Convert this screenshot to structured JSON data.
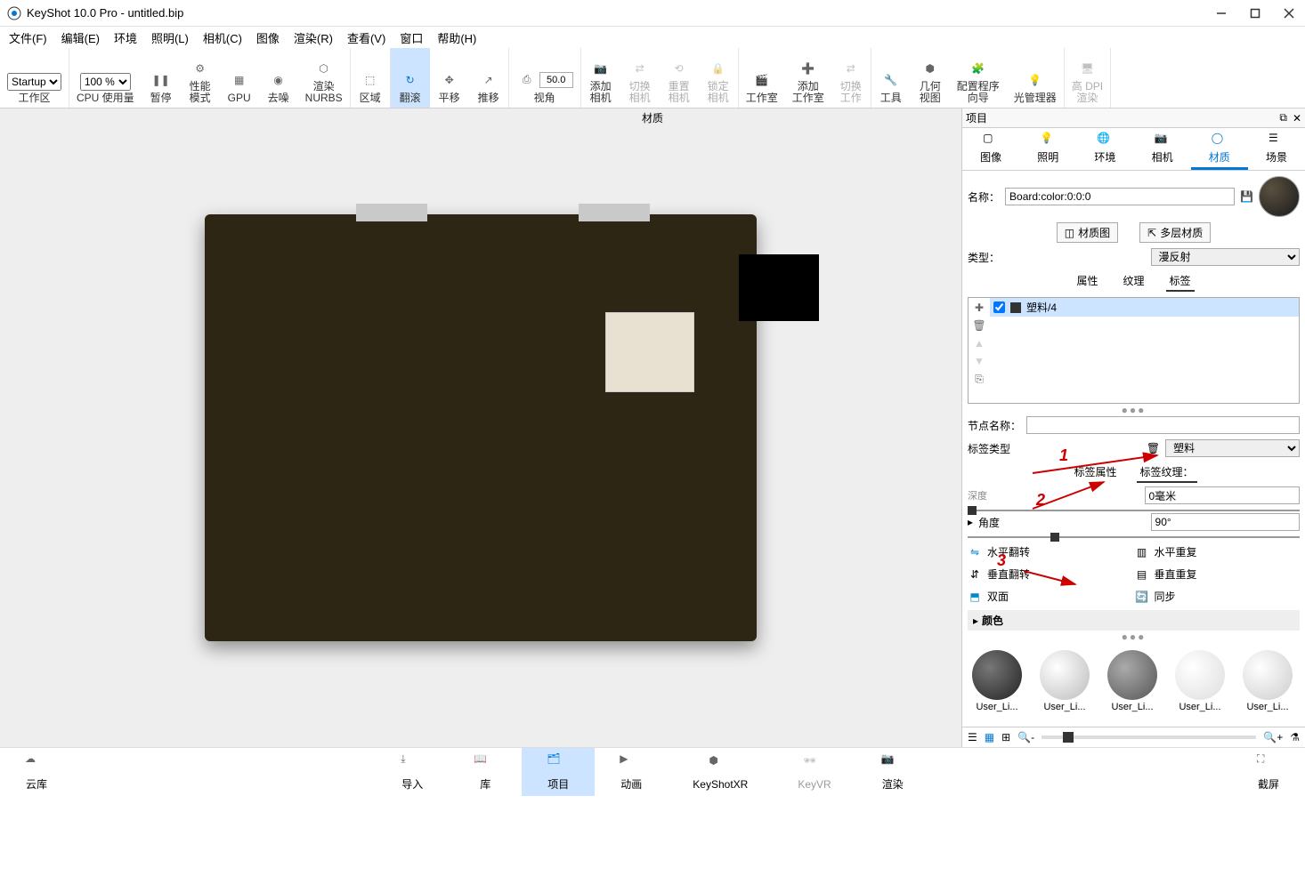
{
  "title": "KeyShot 10.0 Pro  - untitled.bip",
  "menus": [
    "文件(F)",
    "编辑(E)",
    "环境",
    "照明(L)",
    "相机(C)",
    "图像",
    "渲染(R)",
    "查看(V)",
    "窗口",
    "帮助(H)"
  ],
  "toolbar": {
    "startup": "Startup",
    "zoom": "100 %",
    "workspace": "工作区",
    "cpu": "CPU 使用量",
    "pause": "暂停",
    "perf": "性能\n模式",
    "gpu": "GPU",
    "denoise": "去噪",
    "nurbs": "渲染\nNURBS",
    "region": "区域",
    "tumble": "翻滚",
    "pan": "平移",
    "dolly": "推移",
    "view_combo": "50.0",
    "view": "视角",
    "addcam": "添加\n相机",
    "switchcam": "切换\n相机",
    "resetcam": "重置\n相机",
    "lockcam": "锁定\n相机",
    "studio": "工作室",
    "addstudio": "添加\n工作室",
    "switchstudio": "切换\n工作",
    "tools": "工具",
    "geoview": "几何\n视图",
    "wizard": "配置程序\n向导",
    "lightmgr": "光管理器",
    "hidpi": "高 DPI\n渲染"
  },
  "rightpanel": {
    "header_left": "项目",
    "header_center": "材质",
    "tabs": {
      "image": "图像",
      "lighting": "照明",
      "env": "环境",
      "camera": "相机",
      "material": "材质",
      "scene": "场景"
    },
    "name_label": "名称：",
    "name_value": "Board:color:0:0:0",
    "matgraph": "材质图",
    "multimat": "多层材质",
    "type_label": "类型：",
    "type_value": "漫反射",
    "sub": {
      "prop": "属性",
      "tex": "纹理",
      "label": "标签"
    },
    "list_item": "塑料/4",
    "node_label": "节点名称：",
    "labeltype": "标签类型",
    "labeltype_value": "塑料",
    "sub2": {
      "labelprop": "标签属性",
      "labeltex": "标签纹理："
    },
    "depth": "深度",
    "depth_val": "0毫米",
    "angle": "角度",
    "angle_val": "90°",
    "fliph": "水平翻转",
    "reph": "水平重复",
    "flipv": "垂直翻转",
    "repv": "垂直重复",
    "double": "双面",
    "sync": "同步",
    "color": "颜色",
    "swatches": [
      "User_Li...",
      "User_Li...",
      "User_Li...",
      "User_Li...",
      "User_Li..."
    ]
  },
  "annotations": {
    "a1": "1",
    "a2": "2",
    "a3": "3"
  },
  "bottombar": {
    "cloud": "云库",
    "import": "导入",
    "library": "库",
    "project": "项目",
    "anim": "动画",
    "ksxr": "KeyShotXR",
    "keyvr": "KeyVR",
    "render": "渲染",
    "screenshot": "截屏"
  }
}
